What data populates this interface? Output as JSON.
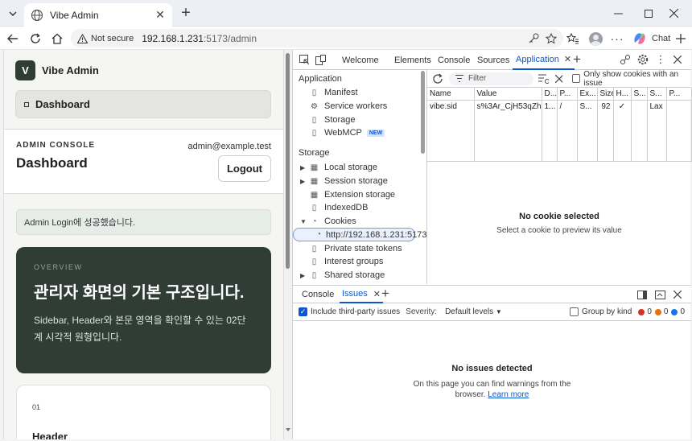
{
  "browser": {
    "tab_title": "Vibe Admin",
    "security": "Not secure",
    "url_host": "192.168.1.231",
    "url_path": ":5173/admin",
    "copilot_label": "Chat"
  },
  "page": {
    "brand_initial": "V",
    "brand_name": "Vibe Admin",
    "nav_dashboard": "Dashboard",
    "eyebrow": "ADMIN CONSOLE",
    "title": "Dashboard",
    "email": "admin@example.test",
    "logout": "Logout",
    "alert": "Admin Login에 성공했습니다.",
    "overview": {
      "eyebrow": "OVERVIEW",
      "title": "관리자 화면의 기본 구조입니다.",
      "desc": "Sidebar, Header와 본문 영역을 확인할 수 있는 02단계 시각적 원형입니다."
    },
    "card2": {
      "num": "01",
      "title": "Header"
    }
  },
  "devtools": {
    "tabs": [
      "Welcome",
      "Elements",
      "Console",
      "Sources",
      "Application"
    ],
    "active_tab": "Application",
    "sidebar": {
      "application_title": "Application",
      "app_items": [
        "Manifest",
        "Service workers",
        "Storage",
        "WebMCP"
      ],
      "new_badge": "NEW",
      "storage_title": "Storage",
      "storage_items": [
        "Local storage",
        "Session storage",
        "Extension storage",
        "IndexedDB",
        "Cookies"
      ],
      "cookie_origin": "http://192.168.1.231:5173",
      "more_items": [
        "Private state tokens",
        "Interest groups",
        "Shared storage"
      ]
    },
    "cookies": {
      "filter_placeholder": "Filter",
      "only_issue_label": "Only show cookies with an issue",
      "columns": [
        "Name",
        "Value",
        "D...",
        "P...",
        "Ex...",
        "Size",
        "H...",
        "S...",
        "S...",
        "P..."
      ],
      "rows": [
        [
          "vibe.sid",
          "s%3Ar_CjH53qZh...",
          "1...",
          "/",
          "S...",
          "92",
          "✓",
          "",
          "Lax",
          ""
        ]
      ],
      "empty_title": "No cookie selected",
      "empty_desc": "Select a cookie to preview its value"
    },
    "drawer": {
      "tabs": [
        "Console",
        "Issues"
      ],
      "active_tab": "Issues",
      "third_party_label": "Include third-party issues",
      "severity_label": "Severity:",
      "severity_value": "Default levels",
      "group_label": "Group by kind",
      "counts": [
        "0",
        "0",
        "0"
      ],
      "empty_title": "No issues detected",
      "empty_desc": "On this page you can find warnings from the browser.",
      "learn_more": "Learn more"
    }
  },
  "colors": {
    "accent": "#0b57d0",
    "brand_dark": "#2f3d36",
    "error": "#d93025",
    "warning": "#e8710a",
    "info": "#1a73e8"
  }
}
